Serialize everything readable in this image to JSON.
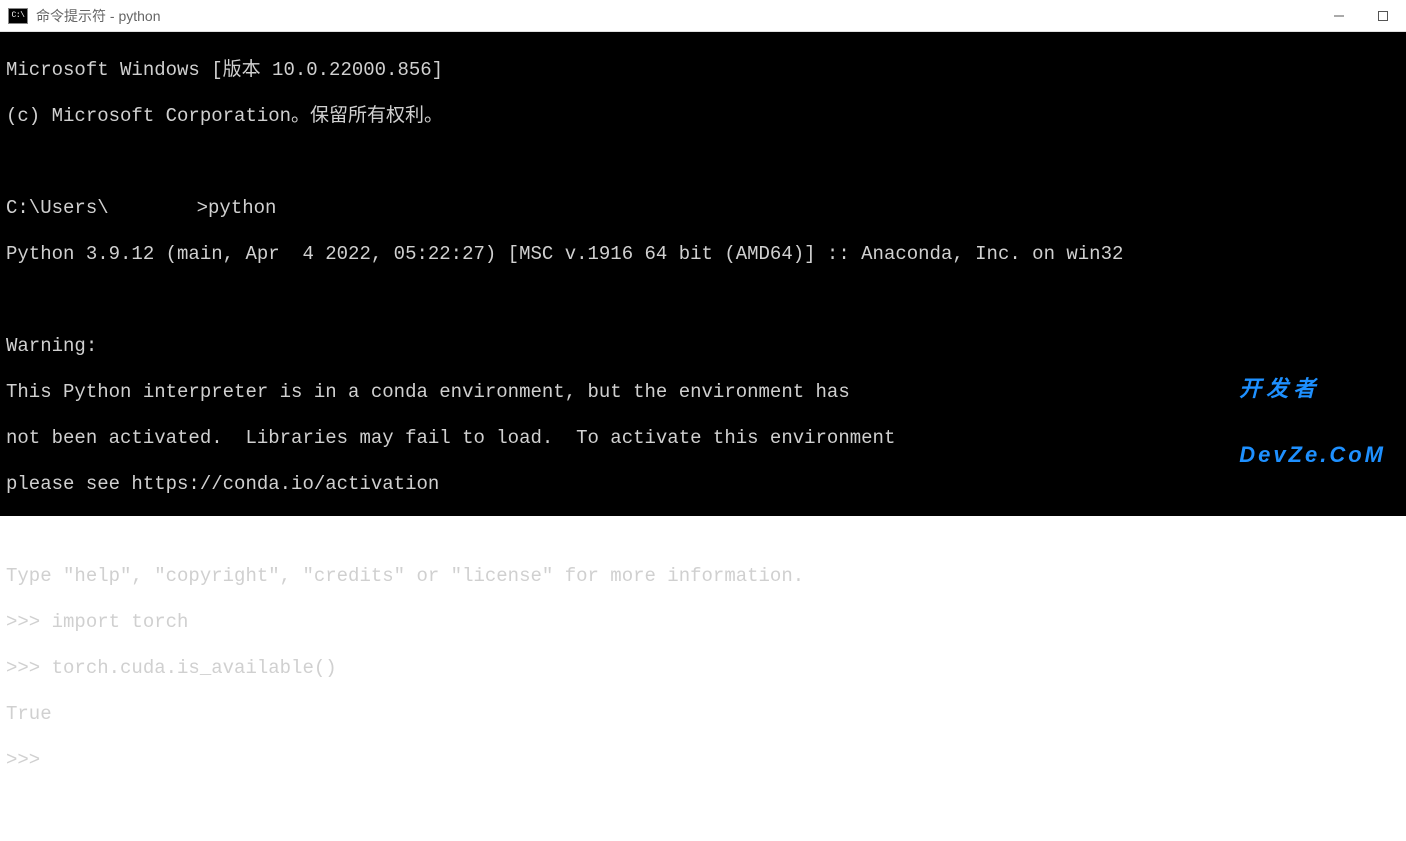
{
  "titlebar": {
    "icon_text": "C:\\",
    "title": "命令提示符 - python"
  },
  "terminal": {
    "lines": [
      "Microsoft Windows [版本 10.0.22000.856]",
      "(c) Microsoft Corporation。保留所有权利。",
      "",
      "C:\\Users\\        >python",
      "Python 3.9.12 (main, Apr  4 2022, 05:22:27) [MSC v.1916 64 bit (AMD64)] :: Anaconda, Inc. on win32",
      "",
      "Warning:",
      "This Python interpreter is in a conda environment, but the environment has",
      "not been activated.  Libraries may fail to load.  To activate this environment",
      "please see https://conda.io/activation",
      "",
      "Type \"help\", \"copyright\", \"credits\" or \"license\" for more information.",
      ">>> import torch",
      ">>> torch.cuda.is_available()",
      "True",
      ">>>"
    ],
    "prompt_prefix": "C:\\Users\\",
    "prompt_suffix": ">python"
  },
  "watermark": {
    "line1": "开发者",
    "line2": "DevZe.CoM"
  }
}
